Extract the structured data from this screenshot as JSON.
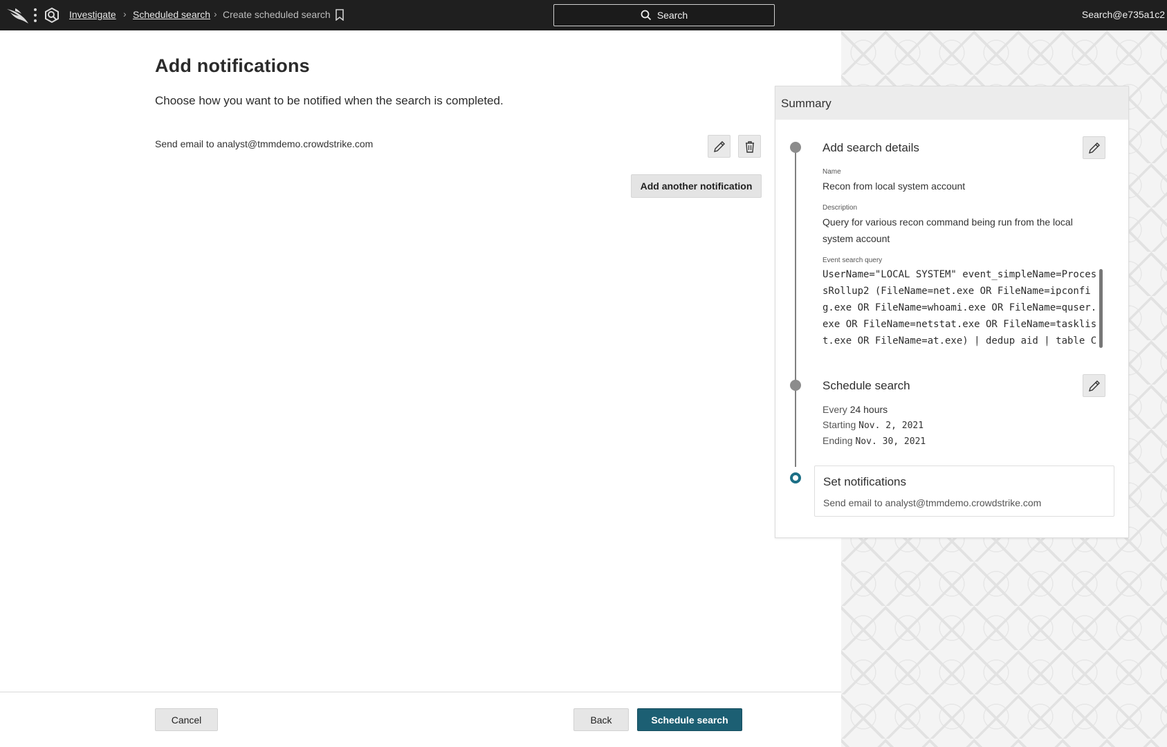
{
  "topbar": {
    "breadcrumbs": [
      "Investigate",
      "Scheduled search",
      "Create scheduled search"
    ],
    "search_label": "Search",
    "user": "Search@e735a1c2"
  },
  "main": {
    "title": "Add notifications",
    "subtitle": "Choose how you want to be notified when the search is completed.",
    "notification": "Send email to analyst@tmmdemo.crowdstrike.com",
    "add_another_label": "Add another notification"
  },
  "footer": {
    "cancel_label": "Cancel",
    "back_label": "Back",
    "schedule_label": "Schedule search"
  },
  "summary": {
    "header": "Summary",
    "details": {
      "title": "Add search details",
      "name_label": "Name",
      "name": "Recon from local system account",
      "description_label": "Description",
      "description": "Query for various recon command being run from the local system account",
      "query_label": "Event search query",
      "query": "UserName=\"LOCAL SYSTEM\" event_simpleName=ProcessRollup2 (FileName=net.exe OR FileName=ipconfig.exe OR FileName=whoami.exe OR FileName=quser.exe OR FileName=netstat.exe OR FileName=tasklist.exe OR FileName=at.exe) | dedup aid | table ComputerName UserName FileName CommandLine"
    },
    "schedule": {
      "title": "Schedule search",
      "every_prefix": "Every",
      "every_value": "24 hours",
      "starting_prefix": "Starting",
      "starting_value": "Nov. 2, 2021",
      "ending_prefix": "Ending",
      "ending_value": "Nov. 30, 2021"
    },
    "notifications": {
      "title": "Set notifications",
      "text": "Send email to analyst@tmmdemo.crowdstrike.com"
    }
  },
  "colors": {
    "topbar": "#1f1f1f",
    "primary": "#1c5f73",
    "active_step": "#1c6f86"
  },
  "icons": [
    "falcon-logo-icon",
    "kebab-menu-icon",
    "investigate-icon",
    "chevron-right-icon",
    "bookmark-icon",
    "search-icon",
    "pencil-icon",
    "trash-icon"
  ]
}
